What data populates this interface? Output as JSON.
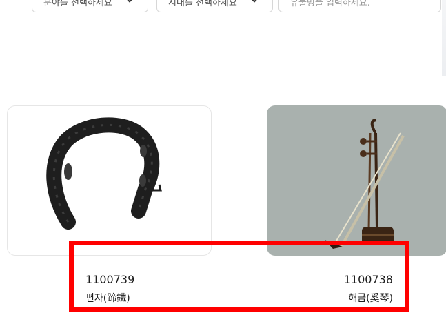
{
  "filters": {
    "category": {
      "label": "분야를 선택하세요"
    },
    "era": {
      "label": "시대를 선택하세요"
    },
    "search": {
      "placeholder": "유물명을 입력하세요."
    }
  },
  "items": [
    {
      "id": "1100739",
      "name": "편자(蹄鐵)",
      "image": "horseshoe-image"
    },
    {
      "id": "1100738",
      "name": "해금(奚琴)",
      "image": "haegeum-image"
    }
  ],
  "colors": {
    "highlight": "#ff0000",
    "card2_bg": "#a9b1ae"
  }
}
